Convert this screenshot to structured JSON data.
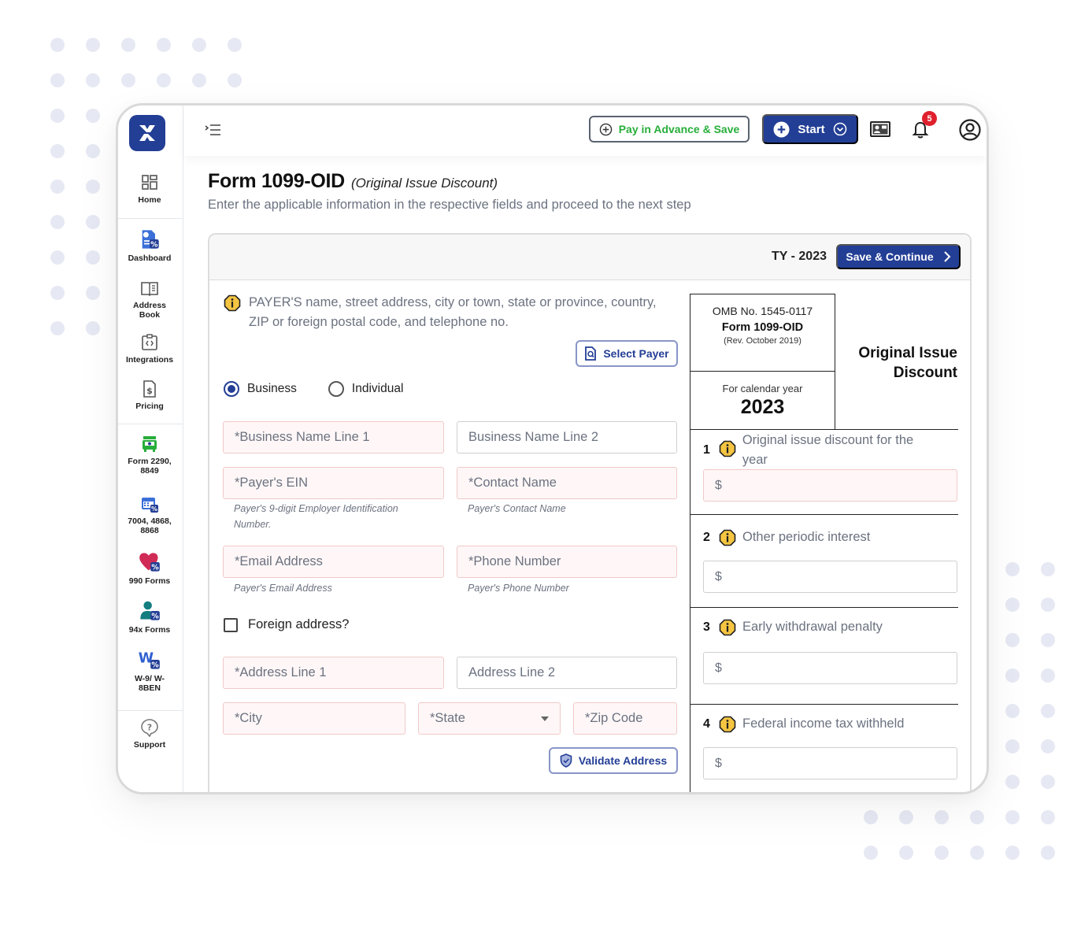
{
  "header": {
    "pay_advance_label": "Pay in Advance & Save",
    "start_label": "Start",
    "notification_count": "5"
  },
  "sidebar": {
    "items": [
      {
        "label": "Home",
        "icon": "grid-icon"
      },
      {
        "label": "Dashboard",
        "icon": "dashboard-icon"
      },
      {
        "label": "Address Book",
        "icon": "book-icon"
      },
      {
        "label": "Integrations",
        "icon": "code-clipboard-icon"
      },
      {
        "label": "Pricing",
        "icon": "dollar-doc-icon"
      },
      {
        "label": "Form 2290, 8849",
        "icon": "truck-icon"
      },
      {
        "label": "7004, 4868, 8868",
        "icon": "calendar-icon"
      },
      {
        "label": "990 Forms",
        "icon": "heart-icon"
      },
      {
        "label": "94x Forms",
        "icon": "person-icon"
      },
      {
        "label": "W-9/ W-8BEN",
        "icon": "w-icon"
      },
      {
        "label": "Support",
        "icon": "help-icon"
      }
    ]
  },
  "page": {
    "title": "Form 1099-OID",
    "subtitle": "(Original Issue Discount)",
    "description": "Enter the applicable information in the respective fields and proceed to the next step"
  },
  "card": {
    "tax_year": "TY - 2023",
    "save_continue_label": "Save & Continue",
    "payer_note": "PAYER'S name, street address, city or town, state or province, country, ZIP or foreign postal code, and telephone no.",
    "select_payer_label": "Select Payer",
    "payer_type": {
      "options": [
        "Business",
        "Individual"
      ],
      "selected": "Business"
    },
    "fields": {
      "business_name_1": {
        "placeholder": "*Business Name Line 1",
        "value": ""
      },
      "business_name_2": {
        "placeholder": "Business Name Line 2",
        "value": ""
      },
      "payer_ein": {
        "placeholder": "*Payer's EIN",
        "value": "",
        "hint": "Payer's 9-digit Employer Identification Number."
      },
      "contact_name": {
        "placeholder": "*Contact Name",
        "value": "",
        "hint": "Payer's Contact Name"
      },
      "email": {
        "placeholder": "*Email Address",
        "value": "",
        "hint": "Payer's Email Address"
      },
      "phone": {
        "placeholder": "*Phone Number",
        "value": "",
        "hint": "Payer's Phone Number"
      },
      "address_1": {
        "placeholder": "*Address Line 1",
        "value": ""
      },
      "address_2": {
        "placeholder": "Address Line 2",
        "value": ""
      },
      "city": {
        "placeholder": "*City",
        "value": ""
      },
      "state": {
        "placeholder": "*State",
        "value": ""
      },
      "zip": {
        "placeholder": "*Zip Code",
        "value": ""
      }
    },
    "foreign_address_label": "Foreign address?",
    "foreign_address_checked": false,
    "validate_address_label": "Validate Address",
    "omb": {
      "omb_no": "OMB No. 1545-0117",
      "form_name": "Form 1099-OID",
      "revision": "(Rev. October 2019)",
      "calendar_label": "For calendar year",
      "calendar_year": "2023"
    },
    "form_heading": "Original Issue Discount",
    "boxes": [
      {
        "num": "1",
        "label": "Original issue discount for the year",
        "currency": "$",
        "value": ""
      },
      {
        "num": "2",
        "label": "Other periodic interest",
        "currency": "$",
        "value": ""
      },
      {
        "num": "3",
        "label": "Early withdrawal penalty",
        "currency": "$",
        "value": ""
      },
      {
        "num": "4",
        "label": "Federal income tax withheld",
        "currency": "$",
        "value": ""
      }
    ]
  },
  "colors": {
    "brand": "#233e95",
    "accent_green": "#27ae3a",
    "badge_red": "#e0202d",
    "required_field_bg": "#fff7f7",
    "info_icon": "#f5c542"
  }
}
